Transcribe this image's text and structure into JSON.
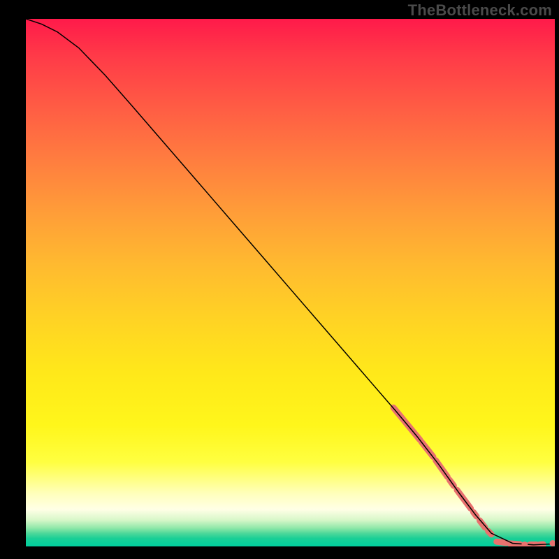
{
  "watermark": "TheBottleneck.com",
  "chart_data": {
    "type": "line",
    "title": "",
    "xlabel": "",
    "ylabel": "",
    "xlim": [
      0,
      100
    ],
    "ylim": [
      0,
      100
    ],
    "grid": false,
    "gradient_colors": {
      "top": "#ff1a4a",
      "mid": "#ffe81a",
      "bottom": "#00ce9e"
    },
    "series": [
      {
        "name": "bottleneck-curve",
        "color": "#000000",
        "stroke_width": 1.5,
        "x": [
          0,
          3,
          6,
          10,
          15,
          20,
          25,
          30,
          35,
          40,
          45,
          50,
          55,
          60,
          65,
          70,
          74,
          78,
          80,
          82,
          85,
          88,
          92,
          96,
          100
        ],
        "y": [
          100,
          99,
          97.5,
          94.5,
          89.3,
          83.6,
          77.8,
          72.0,
          66.2,
          60.4,
          54.6,
          48.8,
          43.0,
          37.2,
          31.4,
          25.6,
          20.8,
          15.6,
          12.8,
          10.0,
          6.0,
          2.5,
          0.6,
          0.3,
          0.5
        ]
      }
    ],
    "highlight_segments": {
      "comment": "dashed/dotted salmon overlay on lower-right tail",
      "color": "#e8716e",
      "stroke_width": 9,
      "segments": [
        {
          "x1": 69.5,
          "y1": 26.3,
          "x2": 74.5,
          "y2": 20.2
        },
        {
          "x1": 74.8,
          "y1": 19.8,
          "x2": 77.0,
          "y2": 17.0
        },
        {
          "x1": 77.5,
          "y1": 16.3,
          "x2": 79.7,
          "y2": 13.2
        },
        {
          "x1": 80.1,
          "y1": 12.6,
          "x2": 80.9,
          "y2": 11.5
        },
        {
          "x1": 81.5,
          "y1": 10.7,
          "x2": 84.1,
          "y2": 7.2
        },
        {
          "x1": 84.6,
          "y1": 6.5,
          "x2": 85.2,
          "y2": 5.7
        },
        {
          "x1": 85.8,
          "y1": 4.9,
          "x2": 86.8,
          "y2": 3.6
        },
        {
          "x1": 87.4,
          "y1": 2.9,
          "x2": 88.0,
          "y2": 2.3
        }
      ],
      "flat_segments": [
        {
          "x1": 89.0,
          "y1": 0.9,
          "x2": 90.8,
          "y2": 0.7
        },
        {
          "x1": 91.5,
          "y1": 0.55,
          "x2": 93.4,
          "y2": 0.4
        },
        {
          "x1": 95.3,
          "y1": 0.35,
          "x2": 96.5,
          "y2": 0.35
        },
        {
          "x1": 97.1,
          "y1": 0.35,
          "x2": 97.8,
          "y2": 0.4
        }
      ],
      "flat_dots": [
        {
          "x": 94.3,
          "y": 0.35
        },
        {
          "x": 99.6,
          "y": 0.6
        }
      ]
    }
  }
}
